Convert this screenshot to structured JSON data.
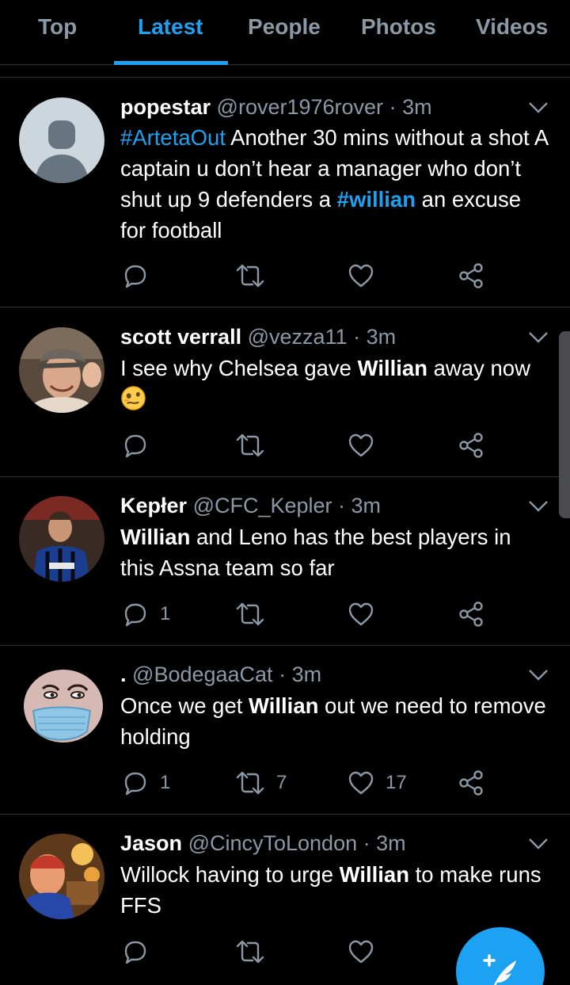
{
  "tabs": [
    "Top",
    "Latest",
    "People",
    "Photos",
    "Videos"
  ],
  "active_tab": "Latest",
  "colors": {
    "accent": "#1da1f2",
    "muted": "#8b98a5",
    "background": "#000000",
    "divider": "#2f3336"
  },
  "tweets": [
    {
      "name": "popestar",
      "handle": "@rover1976rover",
      "time": "3m",
      "avatar": "default-avatar",
      "body_segments": [
        {
          "text": "#ArtetaOut",
          "style": "hashtag"
        },
        {
          "text": "  Another 30 mins without a shot A captain u don’t hear a manager who don’t shut up 9 defenders a ",
          "style": "plain"
        },
        {
          "text": "#willian",
          "style": "hashtag-bold"
        },
        {
          "text": " an excuse for football",
          "style": "plain"
        }
      ],
      "counts": {
        "replies": "",
        "retweets": "",
        "likes": ""
      }
    },
    {
      "name": "scott verrall",
      "handle": "@vezza11",
      "time": "3m",
      "avatar": "photo-man-cap",
      "body_segments": [
        {
          "text": "I see why Chelsea gave ",
          "style": "plain"
        },
        {
          "text": "Willian",
          "style": "bold"
        },
        {
          "text": " away now ",
          "style": "plain"
        }
      ],
      "emoji": "woozy-face-emoji",
      "counts": {
        "replies": "",
        "retweets": "",
        "likes": ""
      }
    },
    {
      "name": "Kepłer",
      "handle": "@CFC_Kepler",
      "time": "3m",
      "avatar": "photo-footballer",
      "body_segments": [
        {
          "text": "Willian",
          "style": "bold"
        },
        {
          "text": " and Leno has the best players in this Assna team so far",
          "style": "plain"
        }
      ],
      "counts": {
        "replies": "1",
        "retweets": "",
        "likes": ""
      }
    },
    {
      "name": ".",
      "handle": "@BodegaaCat",
      "time": "3m",
      "avatar": "cartoon-mask-face",
      "body_segments": [
        {
          "text": "Once we get ",
          "style": "plain"
        },
        {
          "text": "Willian",
          "style": "bold"
        },
        {
          "text": " out we need to remove holding",
          "style": "plain"
        }
      ],
      "counts": {
        "replies": "1",
        "retweets": "7",
        "likes": "17"
      }
    },
    {
      "name": "Jason",
      "handle": "@CincyToLondon",
      "time": "3m",
      "avatar": "photo-man-red",
      "body_segments": [
        {
          "text": "Willock having to urge ",
          "style": "plain"
        },
        {
          "text": "Willian",
          "style": "bold"
        },
        {
          "text": " to make runs FFS",
          "style": "plain"
        }
      ],
      "counts": {
        "replies": "",
        "retweets": "",
        "likes": ""
      }
    }
  ],
  "fab": {
    "icon": "compose-tweet-icon"
  }
}
